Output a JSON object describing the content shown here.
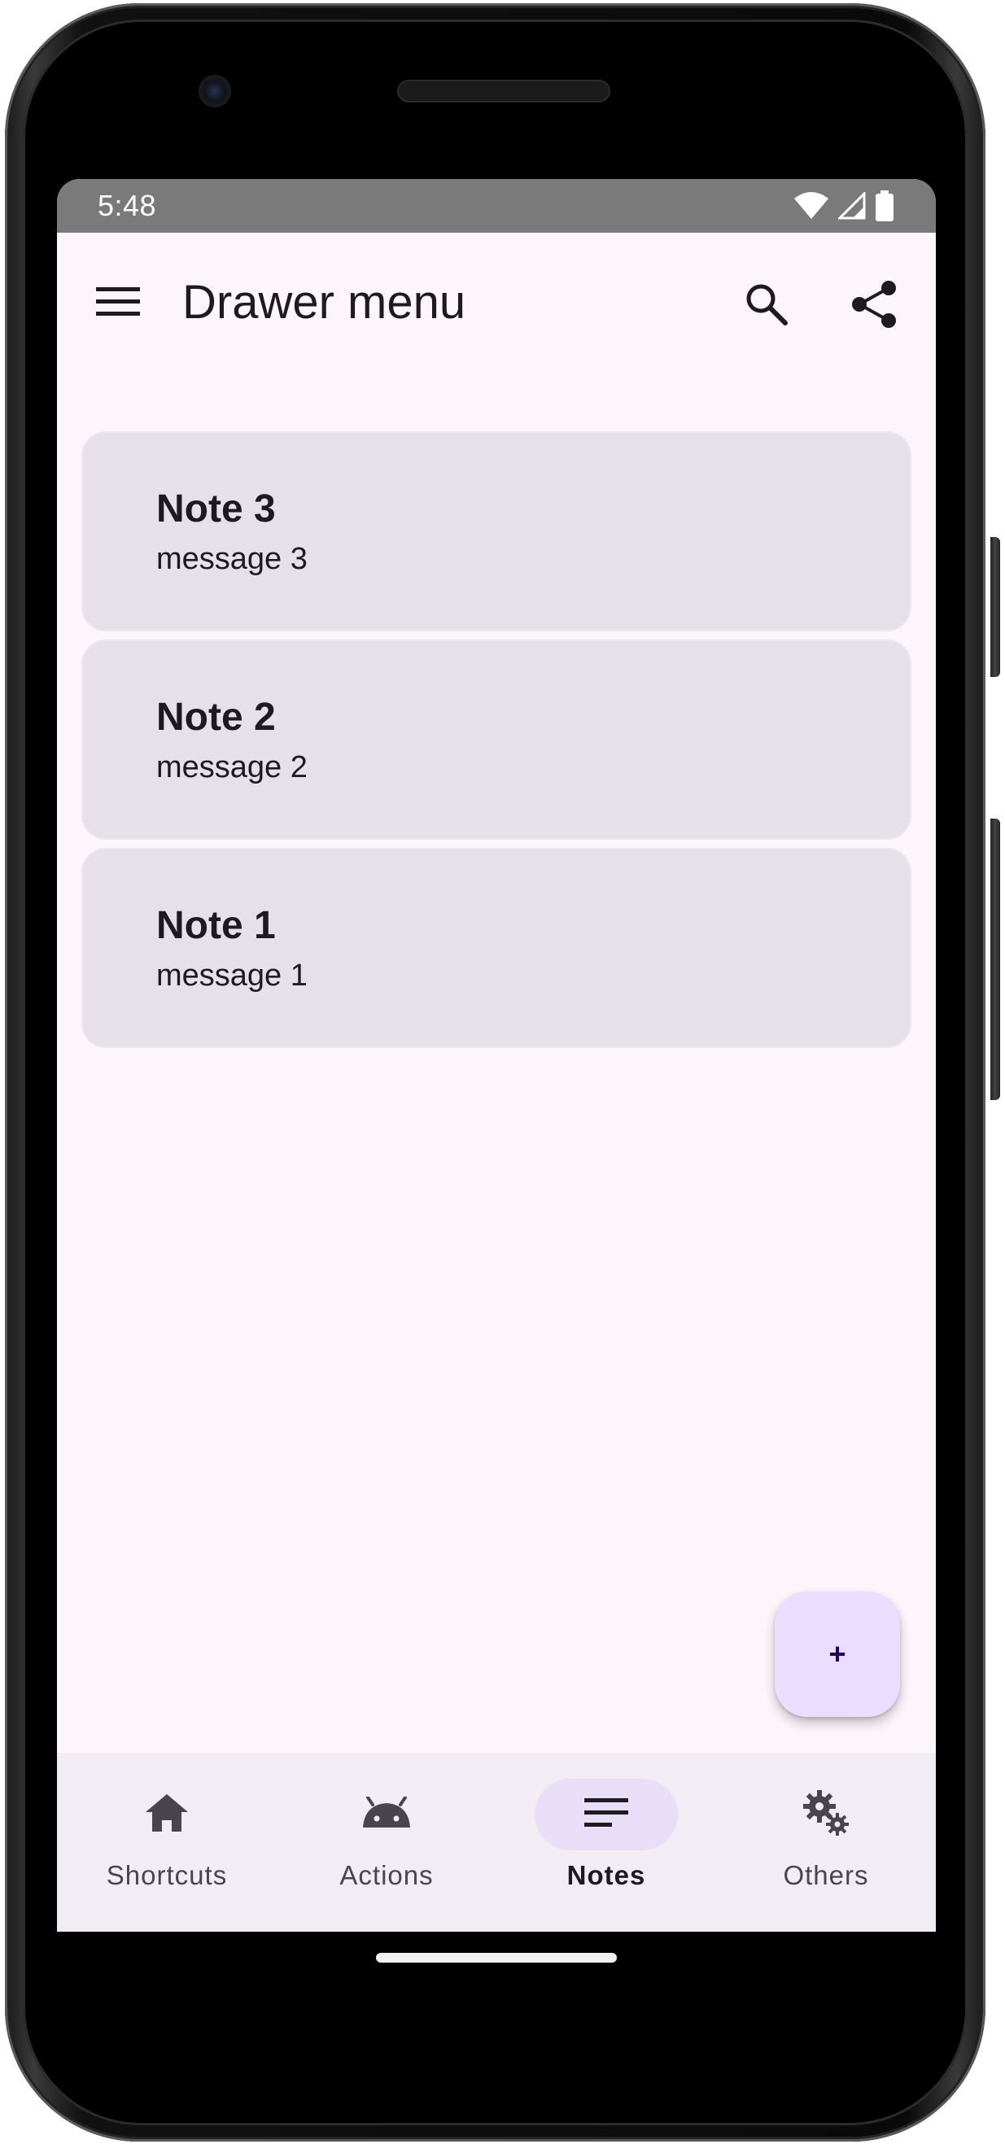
{
  "status_bar": {
    "time": "5:48",
    "icons": [
      "wifi-icon",
      "cell-signal-icon",
      "battery-icon"
    ]
  },
  "app_bar": {
    "title": "Drawer menu",
    "menu_icon": "hamburger-menu-icon",
    "search_icon": "search-icon",
    "share_icon": "share-icon"
  },
  "notes": [
    {
      "title": "Note 3",
      "message": "message 3"
    },
    {
      "title": "Note 2",
      "message": "message 2"
    },
    {
      "title": "Note 1",
      "message": "message 1"
    }
  ],
  "fab": {
    "label": "+"
  },
  "bottom_nav": {
    "items": [
      {
        "label": "Shortcuts",
        "icon": "home-icon",
        "active": false
      },
      {
        "label": "Actions",
        "icon": "android-icon",
        "active": false
      },
      {
        "label": "Notes",
        "icon": "notes-icon",
        "active": true
      },
      {
        "label": "Others",
        "icon": "gears-icon",
        "active": false
      }
    ]
  },
  "colors": {
    "background": "#fcf6fc",
    "card": "#e6e0e8",
    "fab": "#eaddff",
    "nav_background": "#f2ecf4",
    "nav_active_indicator": "#e8def8",
    "status_bar": "#7a7a7a"
  }
}
